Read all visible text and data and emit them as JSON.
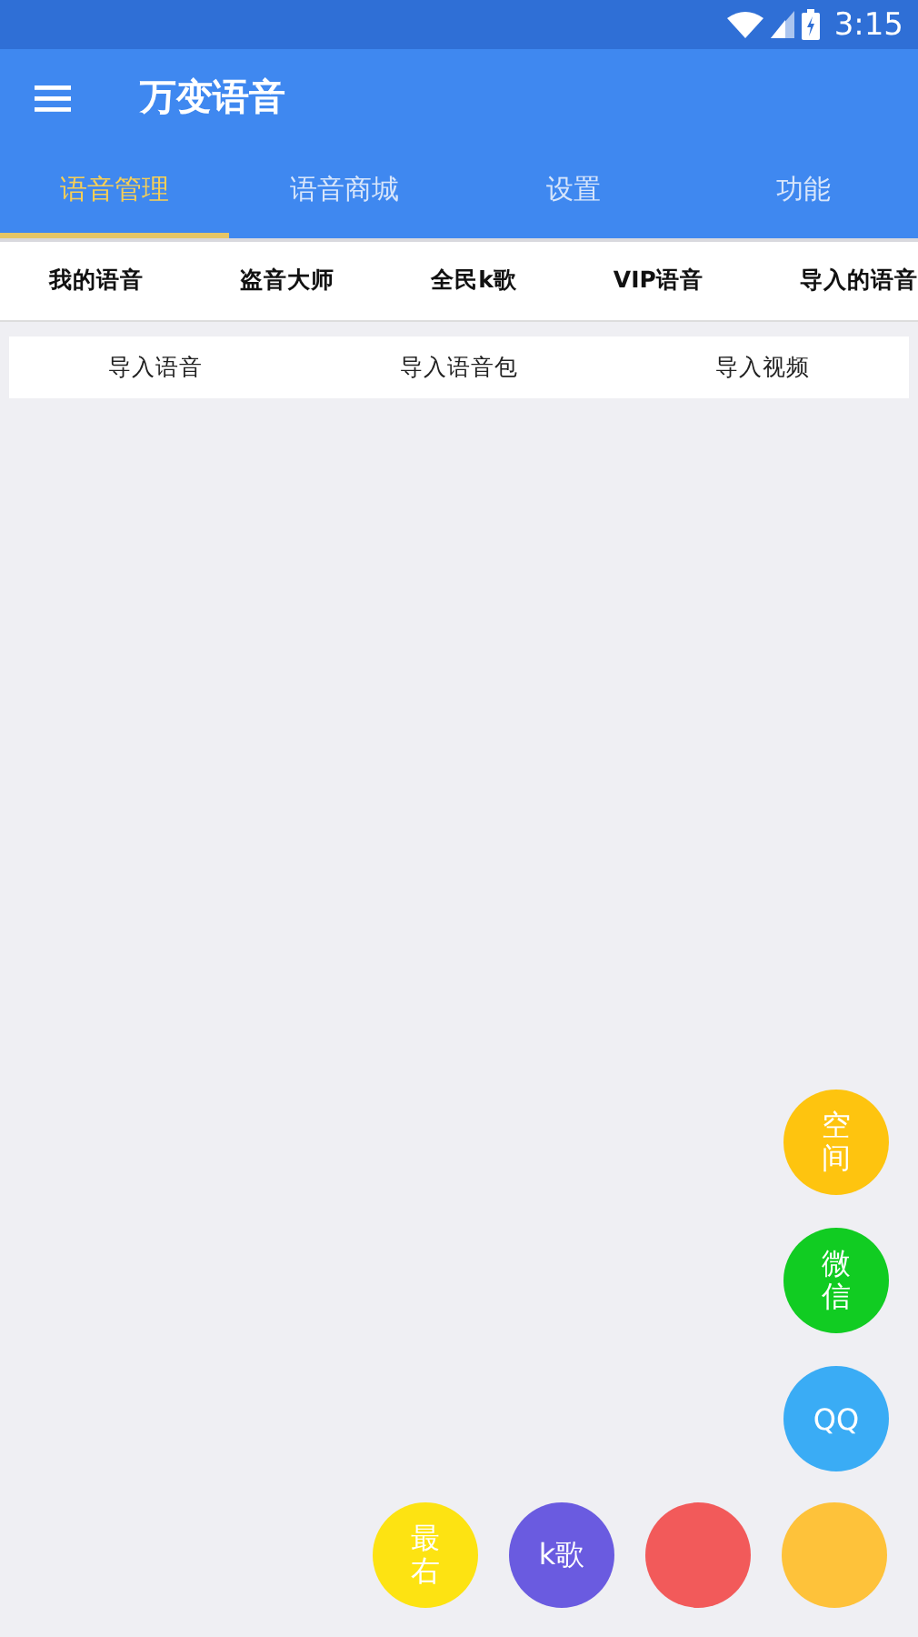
{
  "status_bar": {
    "time": "3:15"
  },
  "app_bar": {
    "title": "万变语音"
  },
  "tabs": [
    {
      "label": "语音管理",
      "selected": true
    },
    {
      "label": "语音商城",
      "selected": false
    },
    {
      "label": "设置",
      "selected": false
    },
    {
      "label": "功能",
      "selected": false
    }
  ],
  "sub_tabs": [
    {
      "label": "我的语音"
    },
    {
      "label": "盗音大师"
    },
    {
      "label": "全民k歌"
    },
    {
      "label": "VIP语音"
    },
    {
      "label": "导入的语音"
    }
  ],
  "import_actions": [
    {
      "label": "导入语音"
    },
    {
      "label": "导入语音包"
    },
    {
      "label": "导入视频"
    }
  ],
  "side_buttons": [
    {
      "label": "空间",
      "vertical": true,
      "color": "#fec40f"
    },
    {
      "label": "微信",
      "vertical": true,
      "color": "#11cc22"
    },
    {
      "label": "QQ",
      "vertical": false,
      "color": "#3aacf5"
    }
  ],
  "bottom_buttons": [
    {
      "label": "最右",
      "vertical": true,
      "color": "#fde312"
    },
    {
      "label": "k歌",
      "vertical": false,
      "color": "#6a5be0"
    },
    {
      "color": "#f25a5a"
    },
    {
      "color": "#fec23a"
    }
  ]
}
